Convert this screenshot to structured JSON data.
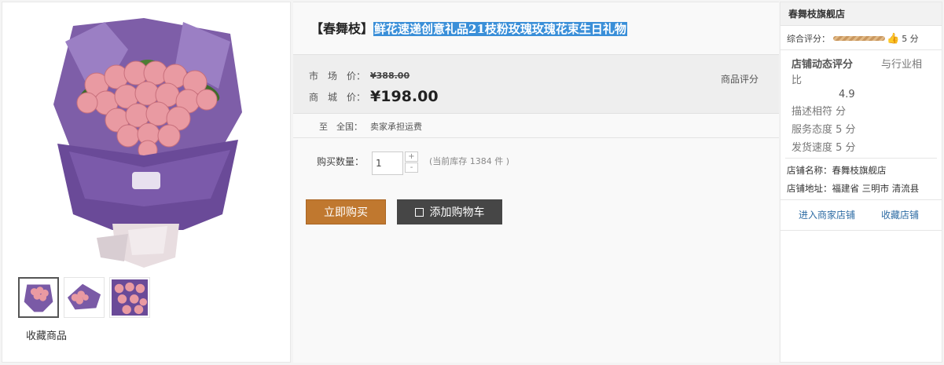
{
  "gallery": {
    "favorite_label": "收藏商品",
    "thumbnails": [
      "thumb-1",
      "thumb-2",
      "thumb-3"
    ],
    "active_thumbnail": 0
  },
  "product": {
    "title_prefix": "【春舞枝】",
    "title_main": "鲜花速递创意礼品21枝粉玫瑰玫瑰花束生日礼物",
    "market_label": "市　场　价：",
    "market_price": "¥388.00",
    "mall_label": "商　城　价：",
    "mall_price": "¥198.00",
    "rating_label": "商品评分",
    "shipping_label": "至　全国：",
    "shipping_text": "卖家承担运费",
    "qty_label": "购买数量：",
    "qty_value": "1",
    "qty_plus": "+",
    "qty_minus": "-",
    "stock_text": "(当前库存 1384 件 )",
    "buy_label": "立即购买",
    "cart_label": "添加购物车"
  },
  "store": {
    "header": "春舞枝旗舰店",
    "overall_label": "综合评分：",
    "overall_score": "5 分",
    "overall_value": 5,
    "dyn_title": "店铺动态评分",
    "industry_compare_1": "与行业相",
    "industry_compare_2": "比",
    "score_value": "4.9",
    "metric_desc": "描述相符 分",
    "metric_service": "服务态度 5 分",
    "metric_shipping": "发货速度 5 分",
    "store_name": "店铺名称：春舞枝旗舰店",
    "store_addr": "店铺地址：福建省 三明市 清流县",
    "enter_label": "进入商家店铺",
    "follow_label": "收藏店铺"
  },
  "colors": {
    "buy_button": "#c0782f",
    "cart_button": "#464646",
    "title_highlight": "#3a8fd8",
    "link": "#2e6ca4"
  },
  "icons": {
    "cart": "cart-icon",
    "rating_thumb": "thumbs-up-icon"
  }
}
